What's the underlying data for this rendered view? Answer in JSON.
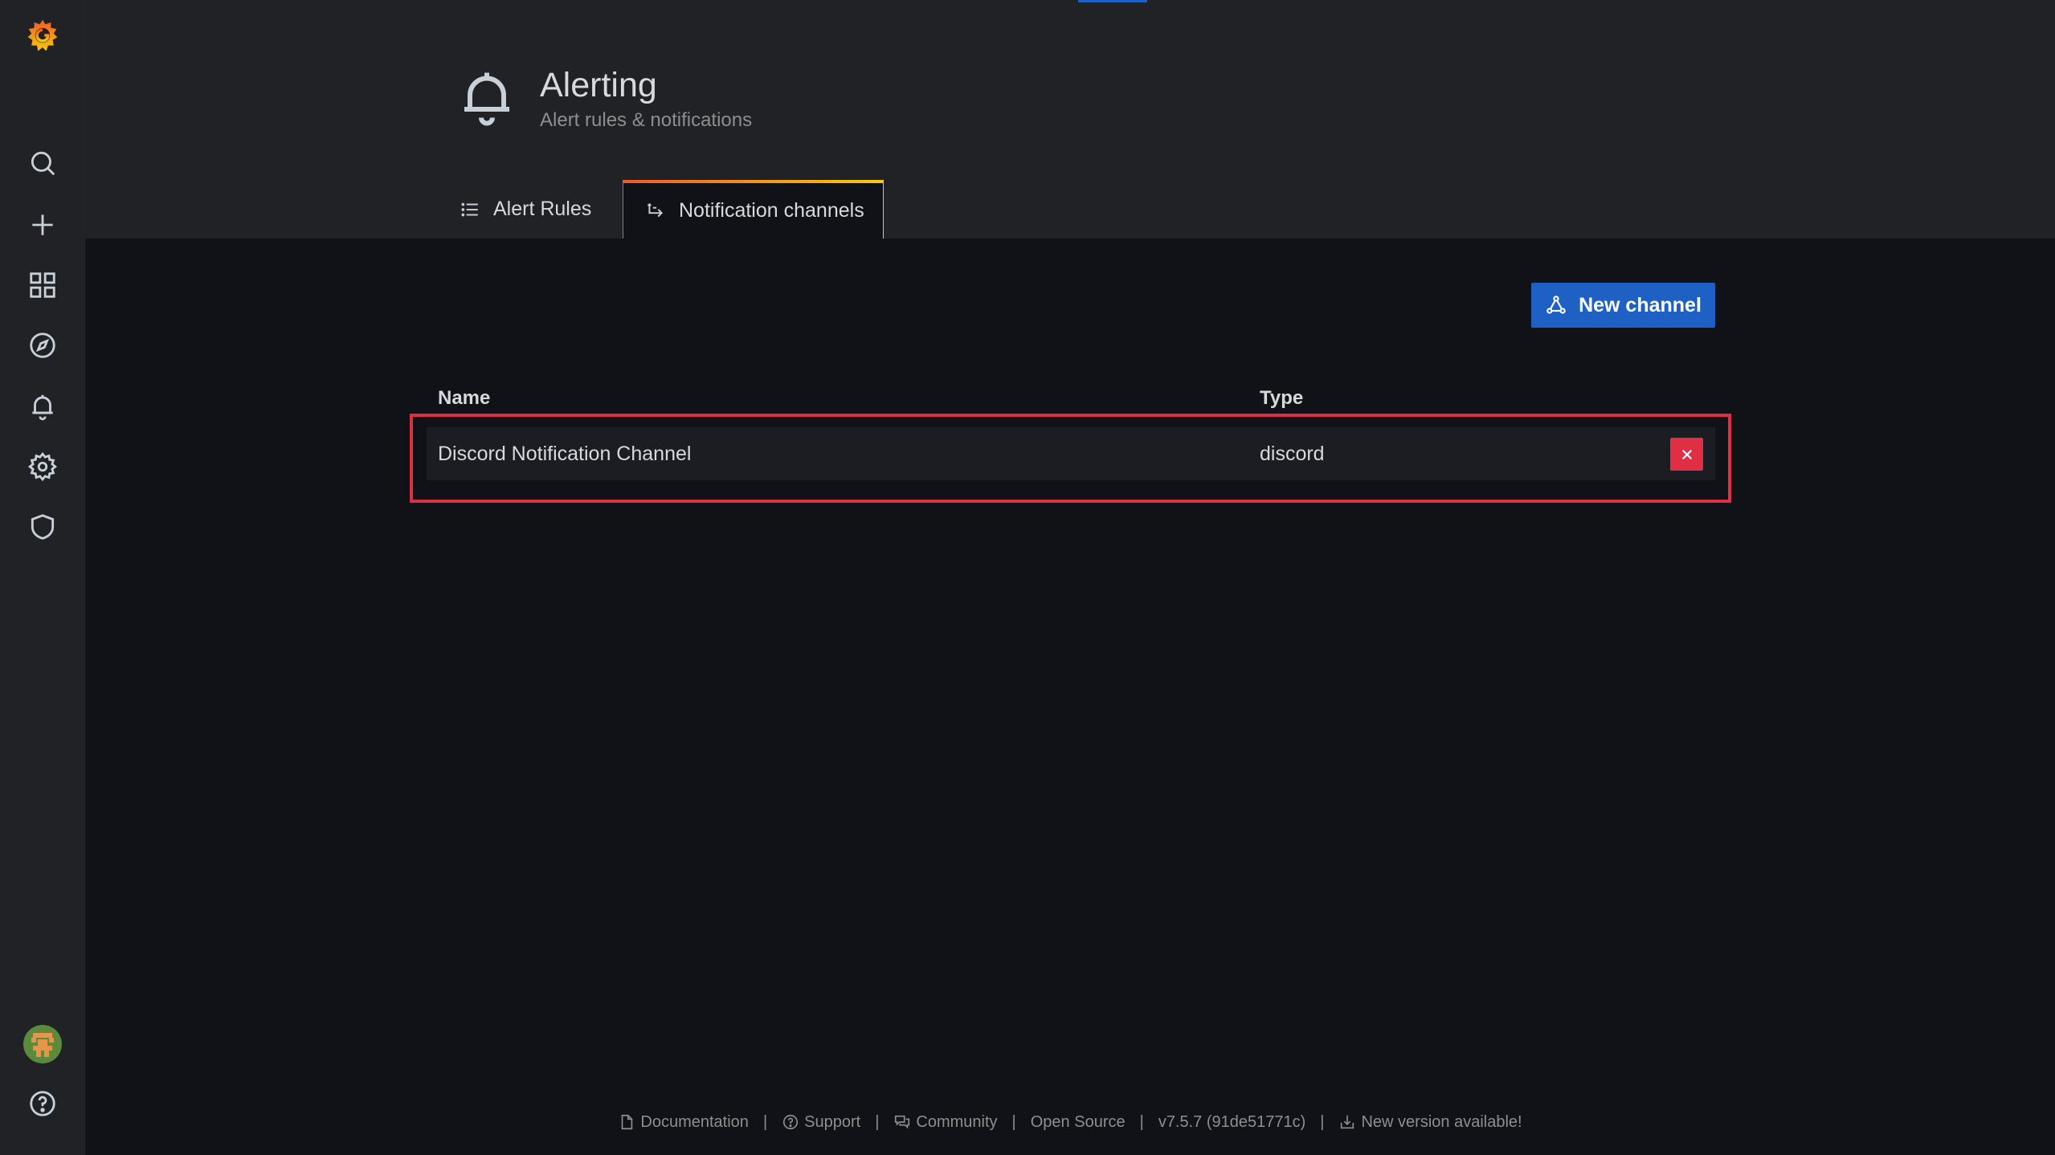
{
  "header": {
    "title": "Alerting",
    "subtitle": "Alert rules & notifications"
  },
  "tabs": [
    {
      "label": "Alert Rules",
      "active": false,
      "icon": "list-icon"
    },
    {
      "label": "Notification channels",
      "active": true,
      "icon": "channel-icon"
    }
  ],
  "actions": {
    "new_channel_label": "New channel"
  },
  "table": {
    "columns": [
      "Name",
      "Type"
    ],
    "rows": [
      {
        "name": "Discord Notification Channel",
        "type": "discord"
      }
    ]
  },
  "footer": {
    "documentation": "Documentation",
    "support": "Support",
    "community": "Community",
    "open_source": "Open Source",
    "version": "v7.5.7 (91de51771c)",
    "new_version": "New version available!",
    "separator": "|"
  },
  "colors": {
    "primary": "#1f60c4",
    "danger": "#e02f44",
    "brand_orange": "#f05a28",
    "brand_yellow": "#fbca0a"
  },
  "sidebar": {
    "icons": [
      "grafana-logo-icon",
      "search-icon",
      "plus-icon",
      "dashboards-icon",
      "explore-icon",
      "alerting-bell-icon",
      "gear-icon",
      "shield-icon",
      "avatar",
      "help-icon"
    ]
  }
}
